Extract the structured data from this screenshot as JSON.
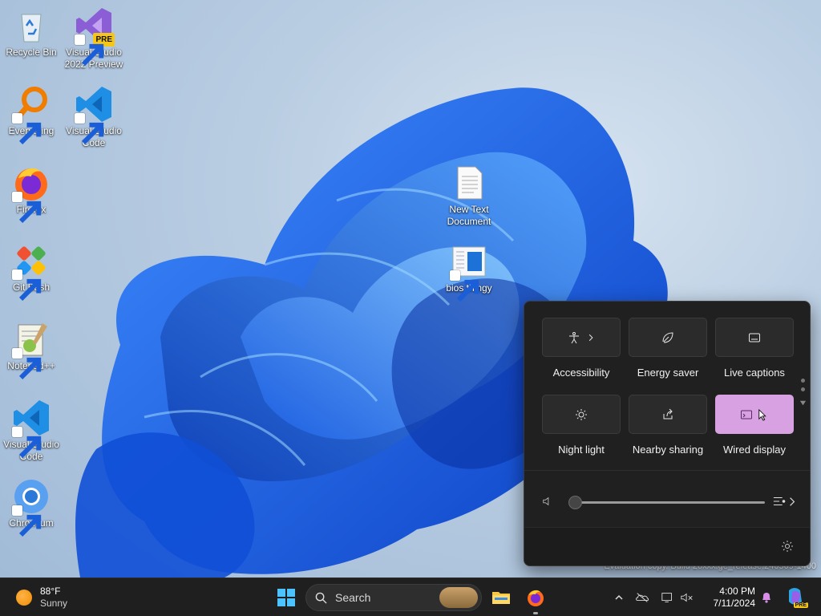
{
  "desktop": {
    "icons_left": [
      {
        "label": "Recycle Bin",
        "icon": "recycle-bin-icon"
      },
      {
        "label": "Visual Studio 2022 Preview",
        "icon": "visual-studio-preview-icon",
        "badge": "PRE"
      },
      {
        "label": "Everything",
        "icon": "everything-search-icon"
      },
      {
        "label": "Visual Studio Code",
        "icon": "vscode-icon"
      },
      {
        "label": "Firefox",
        "icon": "firefox-icon"
      },
      {
        "label": "Git Bash",
        "icon": "git-bash-icon"
      },
      {
        "label": "Notepad++",
        "icon": "notepadpp-icon"
      },
      {
        "label": "Visual Studio Code",
        "icon": "vscode-icon"
      },
      {
        "label": "Chromium",
        "icon": "chromium-icon"
      }
    ],
    "icons_center": [
      {
        "label": "New Text Document",
        "icon": "text-document-icon"
      },
      {
        "label": "bios thingy",
        "icon": "shortcut-file-icon"
      }
    ],
    "watermark": "Evaluation copy. Build 26xxx.ge_release.240509-1400"
  },
  "quick_settings": {
    "tiles": [
      {
        "label": "Accessibility",
        "icon": "accessibility-icon",
        "has_chevron": true,
        "active": false
      },
      {
        "label": "Energy saver",
        "icon": "leaf-icon",
        "has_chevron": false,
        "active": false
      },
      {
        "label": "Live captions",
        "icon": "captions-icon",
        "has_chevron": false,
        "active": false
      },
      {
        "label": "Night light",
        "icon": "sun-icon",
        "has_chevron": false,
        "active": false
      },
      {
        "label": "Nearby sharing",
        "icon": "share-icon",
        "has_chevron": false,
        "active": false
      },
      {
        "label": "Wired display",
        "icon": "cast-icon",
        "has_chevron": false,
        "active": true
      }
    ],
    "volume": {
      "level": 0,
      "muted_icon": "speaker-icon",
      "mixer_icon": "audio-mixer-icon"
    },
    "settings_icon": "gear-icon",
    "active_color": "#d8a1e2"
  },
  "taskbar": {
    "weather": {
      "temp": "88°F",
      "condition": "Sunny"
    },
    "search_placeholder": "Search",
    "pinned": [
      "start-icon",
      "file-explorer-icon",
      "firefox-icon"
    ],
    "tray": [
      "chevron-up-icon",
      "onedrive-offline-icon",
      "network-icon",
      "volume-muted-icon"
    ],
    "clock": {
      "time": "4:00 PM",
      "date": "7/11/2024"
    }
  }
}
